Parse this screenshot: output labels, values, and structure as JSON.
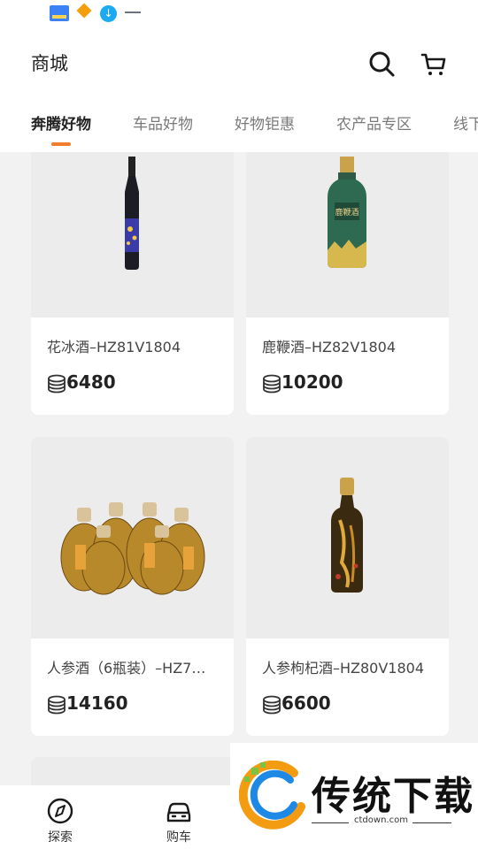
{
  "header": {
    "title": "商城"
  },
  "tabs": [
    {
      "label": "奔腾好物",
      "active": true
    },
    {
      "label": "车品好物",
      "active": false
    },
    {
      "label": "好物钜惠",
      "active": false
    },
    {
      "label": "农产品专区",
      "active": false
    },
    {
      "label": "线下",
      "active": false
    }
  ],
  "products": [
    {
      "name": "花冰酒–HZ81V1804",
      "price": "6480"
    },
    {
      "name": "鹿鞭酒–HZ82V1804",
      "price": "10200"
    },
    {
      "name": "人参酒（6瓶装）–HZ7…",
      "price": "14160"
    },
    {
      "name": "人参枸杞酒–HZ80V1804",
      "price": "6600"
    }
  ],
  "bottom_nav": [
    {
      "label": "探索",
      "icon": "compass-icon"
    },
    {
      "label": "购车",
      "icon": "car-icon"
    }
  ],
  "watermark": {
    "text": "传统下载",
    "url": "ctdown.com"
  },
  "colors": {
    "accent": "#f07c2c",
    "background": "#f2f2f3",
    "card": "#ffffff"
  }
}
